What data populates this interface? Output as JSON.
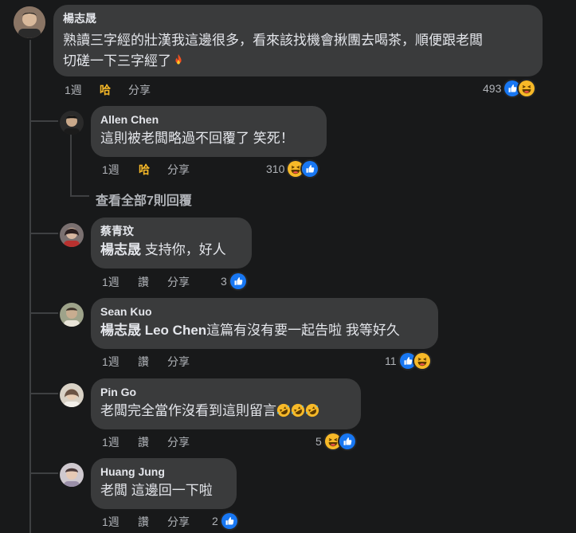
{
  "top_comment": {
    "author": "楊志晟",
    "text_line1": "熟讀三字經的壯漢我這邊很多，看來該找機會揪團去喝茶，順便跟老闆",
    "text_line2": "切磋一下三字經了",
    "emoji": "fire-emoji",
    "time": "1週",
    "reaction_label": "哈",
    "share_label": "分享",
    "reaction_count": "493",
    "reaction_icons": [
      "like-icon",
      "haha-icon"
    ]
  },
  "replies": [
    {
      "author": "Allen Chen",
      "text": "這則被老闆略過不回覆了 笑死！",
      "time": "1週",
      "reaction_label": "哈",
      "share_label": "分享",
      "reaction_count": "310",
      "reaction_icons": [
        "haha-icon",
        "like-icon"
      ]
    },
    {
      "author": "蔡青玟",
      "mention": "楊志晟",
      "text": " 支持你，好人",
      "time": "1週",
      "reaction_label": "讚",
      "share_label": "分享",
      "reaction_count": "3",
      "reaction_icons": [
        "like-icon"
      ]
    },
    {
      "author": "Sean Kuo",
      "mention": "楊志晟 Leo Chen",
      "text": "這篇有沒有要一起告啦 我等好久",
      "time": "1週",
      "reaction_label": "讚",
      "share_label": "分享",
      "reaction_count": "11",
      "reaction_icons": [
        "like-icon",
        "haha-icon"
      ]
    },
    {
      "author": "Pin Go",
      "text": "老闆完全當作沒看到這則留言",
      "emoji": "rofl-emoji x3",
      "time": "1週",
      "reaction_label": "讚",
      "share_label": "分享",
      "reaction_count": "5",
      "reaction_icons": [
        "haha-icon",
        "like-icon"
      ]
    },
    {
      "author": "Huang Jung",
      "text": "老闆 這邊回一下啦",
      "time": "1週",
      "reaction_label": "讚",
      "share_label": "分享",
      "reaction_count": "2",
      "reaction_icons": [
        "like-icon"
      ]
    }
  ],
  "view_all_replies": "查看全部7則回覆",
  "colors": {
    "background": "#18191a",
    "bubble": "#3a3b3c",
    "text": "#e4e6eb",
    "secondary": "#b0b3b8",
    "haha_active": "#f7b928",
    "like_blue": "#1877f2"
  }
}
